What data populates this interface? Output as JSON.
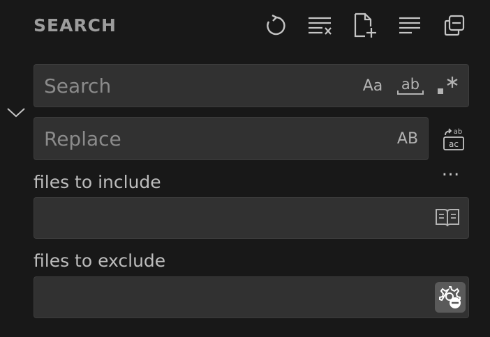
{
  "header": {
    "title": "SEARCH",
    "actions": [
      "refresh-icon",
      "clear-results-icon",
      "new-search-editor-icon",
      "view-as-tree-icon",
      "collapse-all-icon"
    ]
  },
  "search": {
    "placeholder": "Search",
    "value": "",
    "match_case_label": "Aa",
    "whole_word_label": "ab",
    "regex_label": ".*"
  },
  "replace": {
    "placeholder": "Replace",
    "value": "",
    "preserve_case_label": "AB"
  },
  "more_label": "…",
  "include": {
    "label": "files to include",
    "value": ""
  },
  "exclude": {
    "label": "files to exclude",
    "value": ""
  },
  "colors": {
    "background": "#181818",
    "input_background": "#313131",
    "input_border": "#3c3c3c",
    "icon": "#c5c5c5",
    "active_toggle": "#5a5a5a"
  }
}
